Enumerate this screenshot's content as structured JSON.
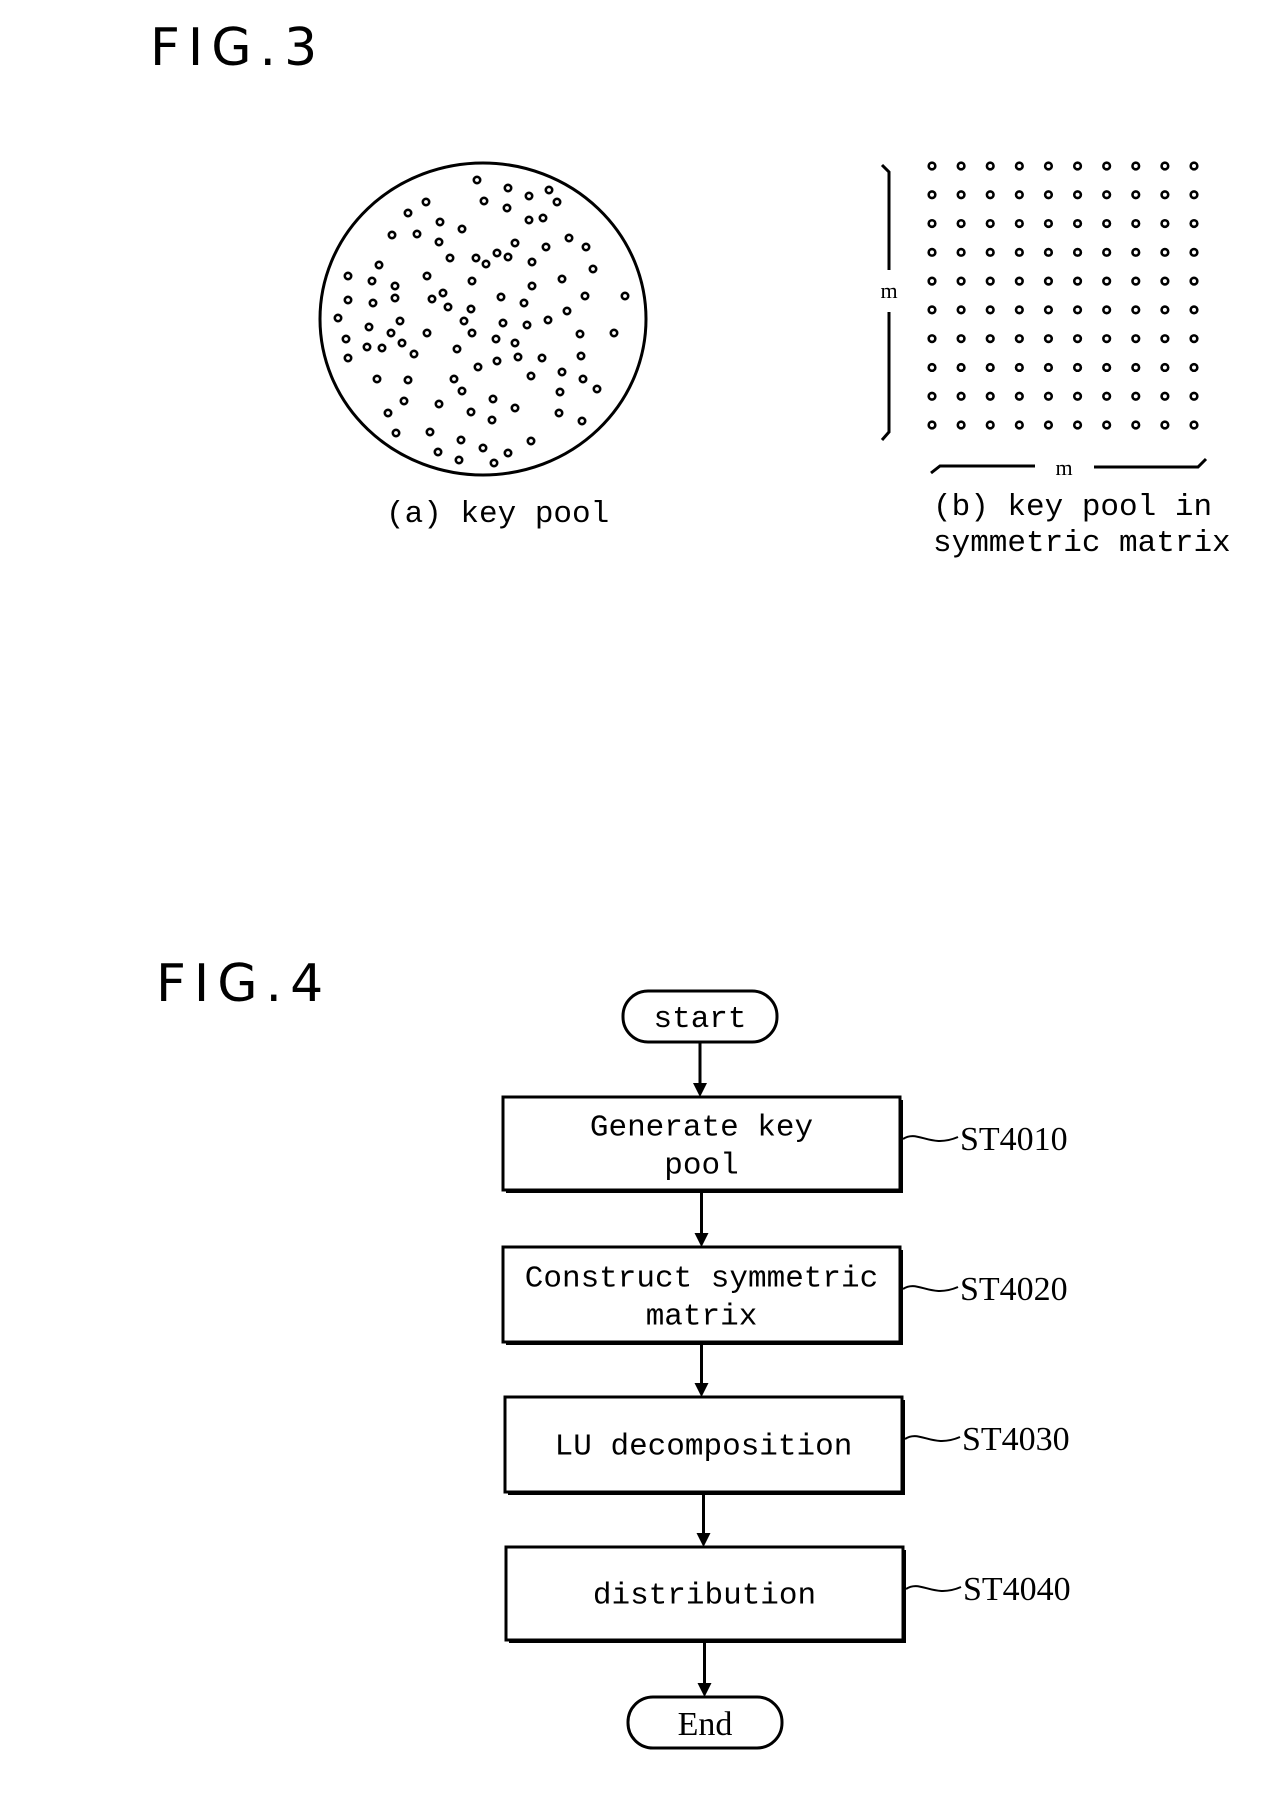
{
  "fig3": {
    "title": "FIG.3",
    "panel_a": {
      "caption": "(a) key pool",
      "dot_count": 96
    },
    "panel_b": {
      "caption_line1": "(b) key pool in",
      "caption_line2": "symmetric matrix",
      "rows": 10,
      "cols": 10,
      "row_dimension_label": "m",
      "col_dimension_label": "m"
    }
  },
  "fig4": {
    "title": "FIG.4",
    "start_label": "start",
    "end_label": "End",
    "steps": [
      {
        "lines": [
          "Generate key",
          "pool"
        ],
        "ref": "ST4010"
      },
      {
        "lines": [
          "Construct symmetric",
          "matrix"
        ],
        "ref": "ST4020"
      },
      {
        "lines": [
          "LU decomposition"
        ],
        "ref": "ST4030"
      },
      {
        "lines": [
          "distribution"
        ],
        "ref": "ST4040"
      }
    ]
  }
}
